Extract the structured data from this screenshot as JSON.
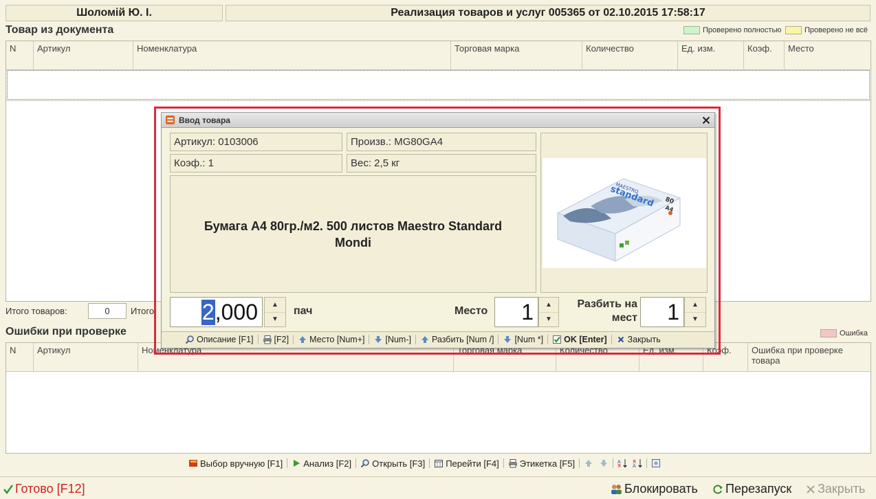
{
  "header": {
    "user": "Шоломій Ю. І.",
    "document_title": "Реализация товаров и услуг 005365 от 02.10.2015 17:58:17"
  },
  "doc_section": {
    "title": "Товар из документа",
    "legend": [
      {
        "label": "Проверено полностью",
        "color": "#ccf5c9"
      },
      {
        "label": "Проверено не всё",
        "color": "#faf6a3"
      }
    ],
    "columns": [
      "N",
      "Артикул",
      "Номенклатура",
      "Торговая марка",
      "Количество",
      "Ед. изм.",
      "Коэф.",
      "Место"
    ]
  },
  "totals": {
    "goods_label": "Итого товаров:",
    "goods_value": "0",
    "partial_label": "Итого"
  },
  "errors_section": {
    "title": "Ошибки при проверке",
    "legend": [
      {
        "label": "Ошибка",
        "color": "#f5c6c6"
      }
    ],
    "columns": [
      "N",
      "Артикул",
      "Номенклатура",
      "Торговая марка",
      "Количество",
      "Ед. изм.",
      "Коэф.",
      "Ошибка при проверке товара"
    ]
  },
  "bottom_toolbar": {
    "items": [
      {
        "label": "Выбор вручную [F1]",
        "icon": "book-icon"
      },
      {
        "label": "Анализ [F2]",
        "icon": "play-icon"
      },
      {
        "label": "Открыть [F3]",
        "icon": "magnifier-icon"
      },
      {
        "label": "Перейти [F4]",
        "icon": "calendar-icon"
      },
      {
        "label": "Этикетка [F5]",
        "icon": "printer-icon"
      }
    ]
  },
  "status_bar": {
    "ready": "Готово [F12]",
    "lock": "Блокировать",
    "restart": "Перезапуск",
    "close": "Закрыть"
  },
  "dialog": {
    "title": "Ввод товара",
    "article": "Артикул: 0103006",
    "manufacturer": "Произв.: MG80GA4",
    "coef": "Коэф.: 1",
    "weight": "Вес: 2,5 кг",
    "product_name": "Бумага А4 80гр./м2. 500 листов Maestro Standard Mondi",
    "quantity_selected": "2",
    "quantity_rest": ",000",
    "unit": "пач",
    "place_label": "Место",
    "place_value": "1",
    "split_label_1": "Разбить на",
    "split_label_2": "мест",
    "split_value": "1",
    "product_image_brand": "MAESTRO",
    "product_image_line": "standard",
    "product_image_weight": "80",
    "product_image_format": "A4",
    "toolbar": {
      "description": "Описание [F1]",
      "f2": "[F2]",
      "place_plus": "Место [Num+]",
      "num_minus": "[Num-]",
      "split": "Разбить [Num /]",
      "num_mult": "[Num *]",
      "ok": "OK [Enter]",
      "close": "Закрыть"
    }
  },
  "colors": {
    "highlight": "#e0263d",
    "selection": "#3965c4",
    "ready_text": "#d22020"
  }
}
